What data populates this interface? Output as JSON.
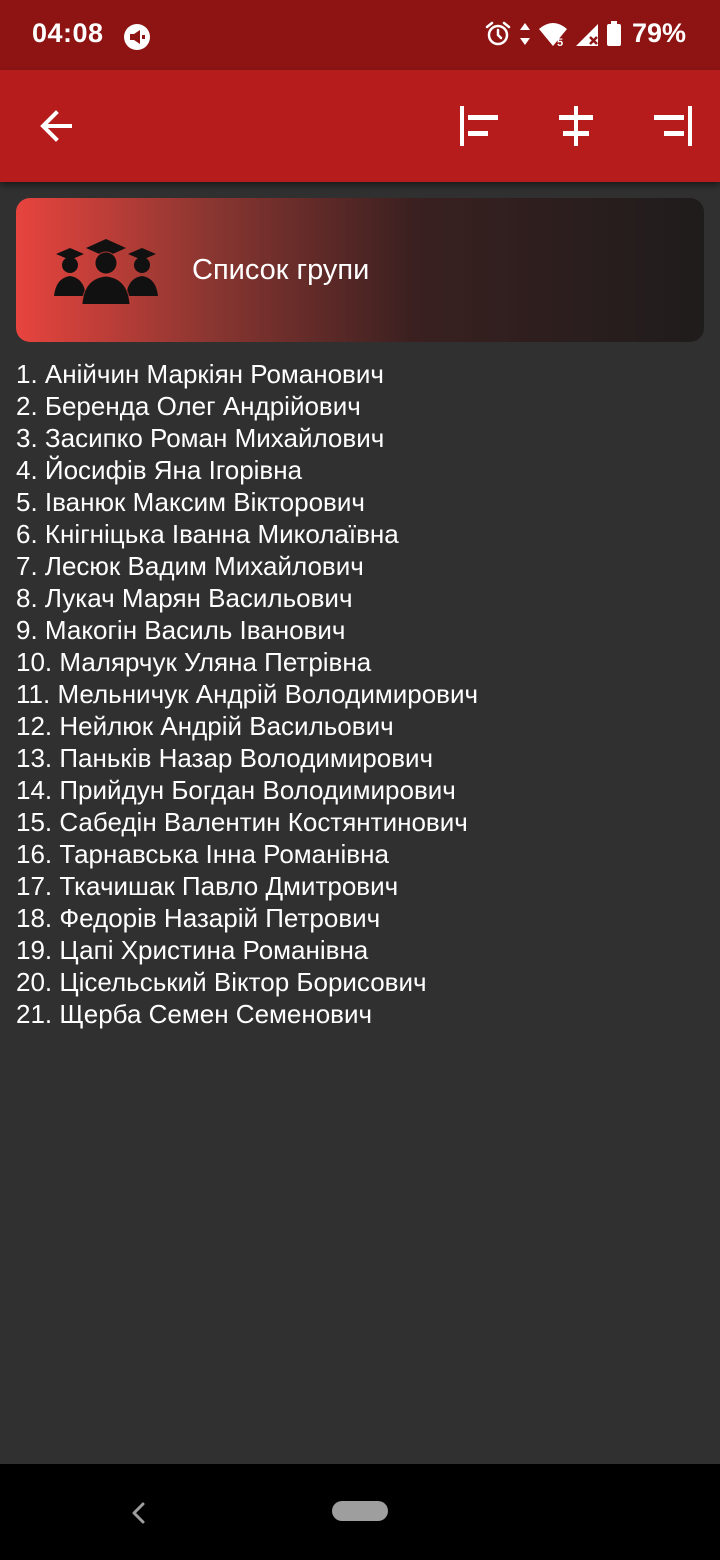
{
  "status_bar": {
    "time": "04:08",
    "battery": "79%",
    "icons": [
      "app-notification-icon",
      "alarm-icon",
      "data-arrows-icon",
      "wifi-icon",
      "signal-icon",
      "battery-icon"
    ]
  },
  "app_bar": {
    "icons": [
      "back-arrow-icon",
      "align-left-icon",
      "align-center-icon",
      "align-right-icon"
    ],
    "color": "#b71c1c"
  },
  "header": {
    "title": "Список групи",
    "icon": "graduates-icon"
  },
  "students": [
    "1. Анійчин Маркіян Романович",
    "2. Беренда Олег Андрійович",
    "3. Засипко Роман Михайлович",
    "4. Йосифів Яна Ігорівна",
    "5. Іванюк Максим Вікторович",
    "6. Кнігніцька Іванна Миколаївна",
    "7. Лесюк Вадим Михайлович",
    "8. Лукач Марян Васильович",
    "9. Макогін Василь Іванович",
    "10. Малярчук Уляна Петрівна",
    "11. Мельничук Андрій Володимирович",
    "12. Нейлюк Андрій Васильович",
    "13. Паньків Назар Володимирович",
    "14. Прийдун Богдан Володимирович",
    "15. Сабедін Валентин Костянтинович",
    "16. Тарнавська Інна Романівна",
    "17. Ткачишак Павло Дмитрович",
    "18. Федорів Назарій Петрович",
    "19. Цапі Христина Романівна",
    "20. Цісельський Віктор Борисович",
    "21. Щерба Семен Семенович"
  ],
  "colors": {
    "status_bar": "#8e1414",
    "background": "#303030",
    "accent": "#e8443e"
  }
}
